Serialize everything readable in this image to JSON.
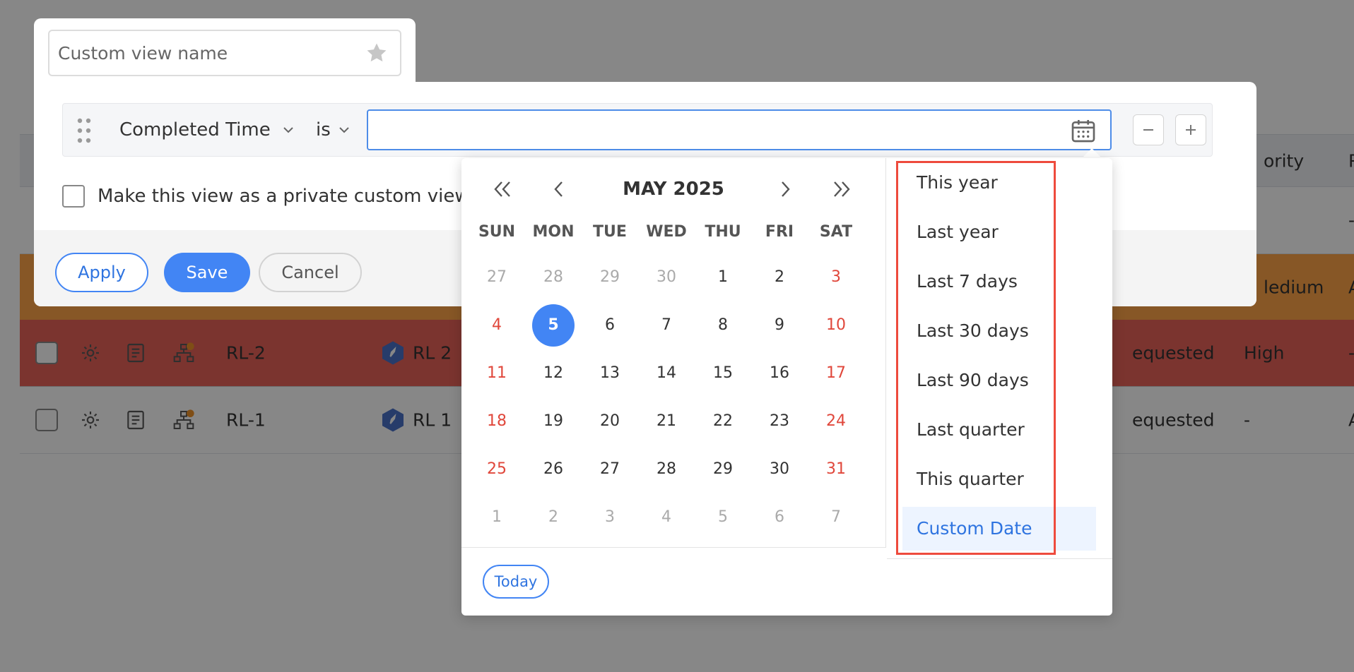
{
  "table": {
    "header": {
      "priority": "ority",
      "extra": "P"
    },
    "rows": [
      {
        "dash": "-"
      },
      {
        "priority": "ledium",
        "extra": "A"
      },
      {
        "id": "RL-2",
        "name": "RL 2",
        "status": "equested",
        "priority": "High",
        "extra": "-"
      },
      {
        "id": "RL-1",
        "name": "RL 1",
        "status": "equested",
        "priority": "-",
        "extra": "A"
      }
    ]
  },
  "dialog": {
    "name_placeholder": "Custom view name",
    "condition": {
      "field": "Completed Time",
      "operator": "is",
      "value": ""
    },
    "private_label": "Make this view as a private custom view",
    "buttons": {
      "apply": "Apply",
      "save": "Save",
      "cancel": "Cancel"
    }
  },
  "picker": {
    "month_title": "MAY 2025",
    "weekdays": [
      "SUN",
      "MON",
      "TUE",
      "WED",
      "THU",
      "FRI",
      "SAT"
    ],
    "weeks": [
      [
        "27",
        "28",
        "29",
        "30",
        "1",
        "2",
        "3"
      ],
      [
        "4",
        "5",
        "6",
        "7",
        "8",
        "9",
        "10"
      ],
      [
        "11",
        "12",
        "13",
        "14",
        "15",
        "16",
        "17"
      ],
      [
        "18",
        "19",
        "20",
        "21",
        "22",
        "23",
        "24"
      ],
      [
        "25",
        "26",
        "27",
        "28",
        "29",
        "30",
        "31"
      ],
      [
        "1",
        "2",
        "3",
        "4",
        "5",
        "6",
        "7"
      ]
    ],
    "selected_day": "5",
    "today_label": "Today",
    "presets": [
      "This year",
      "Last year",
      "Last 7 days",
      "Last 30 days",
      "Last 90 days",
      "Last quarter",
      "This quarter",
      "Custom Date"
    ],
    "active_preset": "Custom Date"
  },
  "colors": {
    "accent": "#4285f4",
    "weekend": "#e0473b",
    "row_orange": "#ffa548",
    "row_red": "#e8625a",
    "highlight": "#ee4b3d"
  }
}
